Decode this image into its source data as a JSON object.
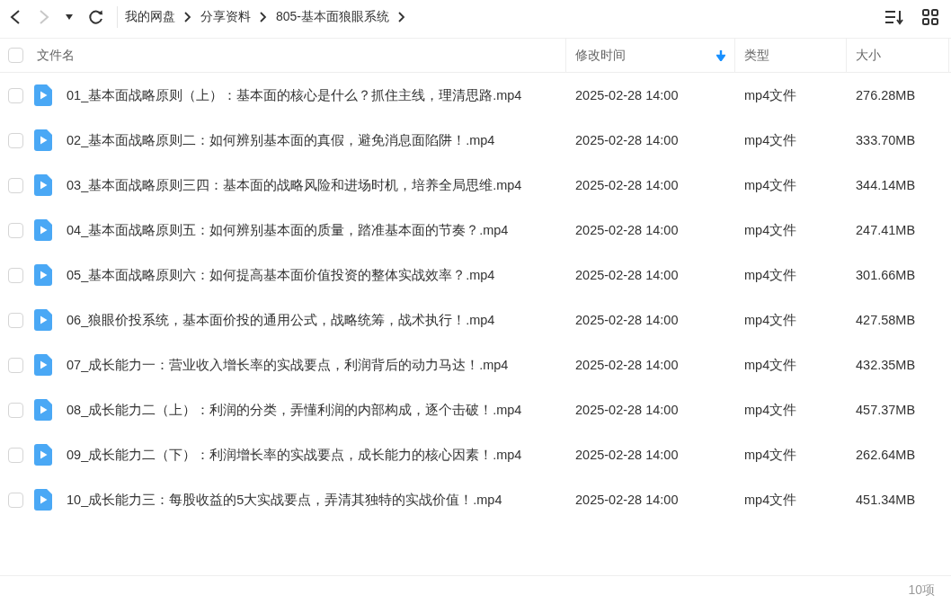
{
  "toolbar": {
    "breadcrumbs": [
      "我的网盘",
      "分享资料",
      "805-基本面狼眼系统"
    ],
    "forward_disabled": true
  },
  "table": {
    "select_all_checked": false,
    "columns": [
      {
        "label": "文件名",
        "sorted": false
      },
      {
        "label": "修改时间",
        "sorted": true
      },
      {
        "label": "类型",
        "sorted": false
      },
      {
        "label": "大小",
        "sorted": false
      }
    ],
    "rows": [
      {
        "name": "01_基本面战略原则（上）：基本面的核心是什么？抓住主线，理清思路.mp4",
        "modified": "2025-02-28 14:00",
        "type": "mp4文件",
        "size": "276.28MB",
        "checked": false
      },
      {
        "name": "02_基本面战略原则二：如何辨别基本面的真假，避免消息面陷阱！.mp4",
        "modified": "2025-02-28 14:00",
        "type": "mp4文件",
        "size": "333.70MB",
        "checked": false
      },
      {
        "name": "03_基本面战略原则三四：基本面的战略风险和进场时机，培养全局思维.mp4",
        "modified": "2025-02-28 14:00",
        "type": "mp4文件",
        "size": "344.14MB",
        "checked": false
      },
      {
        "name": "04_基本面战略原则五：如何辨别基本面的质量，踏准基本面的节奏？.mp4",
        "modified": "2025-02-28 14:00",
        "type": "mp4文件",
        "size": "247.41MB",
        "checked": false
      },
      {
        "name": "05_基本面战略原则六：如何提高基本面价值投资的整体实战效率？.mp4",
        "modified": "2025-02-28 14:00",
        "type": "mp4文件",
        "size": "301.66MB",
        "checked": false
      },
      {
        "name": "06_狼眼价投系统，基本面价投的通用公式，战略统筹，战术执行！.mp4",
        "modified": "2025-02-28 14:00",
        "type": "mp4文件",
        "size": "427.58MB",
        "checked": false
      },
      {
        "name": "07_成长能力一：营业收入增长率的实战要点，利润背后的动力马达！.mp4",
        "modified": "2025-02-28 14:00",
        "type": "mp4文件",
        "size": "432.35MB",
        "checked": false
      },
      {
        "name": "08_成长能力二（上）：利润的分类，弄懂利润的内部构成，逐个击破！.mp4",
        "modified": "2025-02-28 14:00",
        "type": "mp4文件",
        "size": "457.37MB",
        "checked": false
      },
      {
        "name": "09_成长能力二（下）：利润增长率的实战要点，成长能力的核心因素！.mp4",
        "modified": "2025-02-28 14:00",
        "type": "mp4文件",
        "size": "262.64MB",
        "checked": false
      },
      {
        "name": "10_成长能力三：每股收益的5大实战要点，弄清其独特的实战价值！.mp4",
        "modified": "2025-02-28 14:00",
        "type": "mp4文件",
        "size": "451.34MB",
        "checked": false
      }
    ]
  },
  "status_bar": {
    "count": "10项"
  }
}
